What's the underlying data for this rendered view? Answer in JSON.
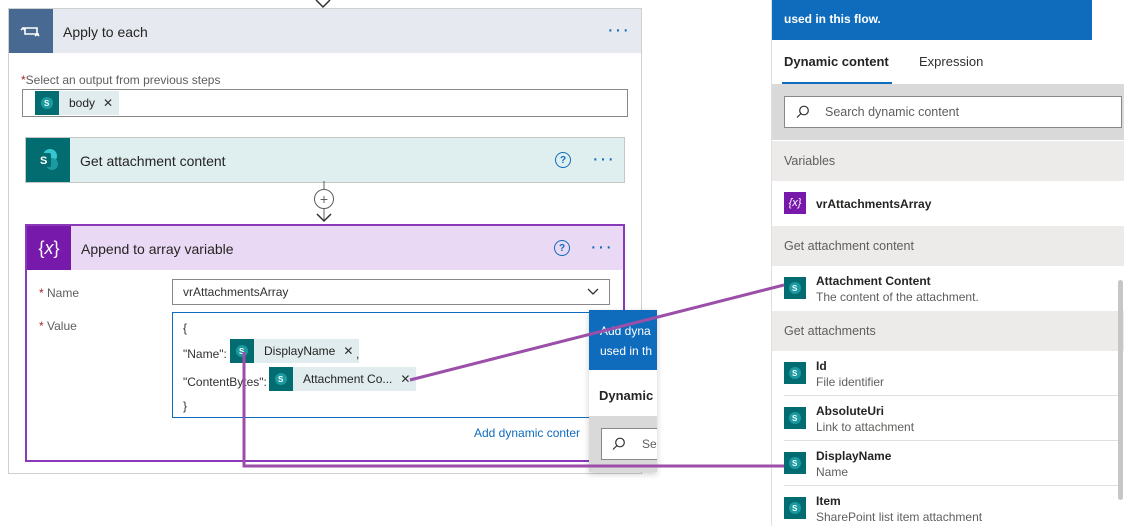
{
  "apply_each": {
    "title": "Apply to each",
    "output_label": "Select an output from previous steps",
    "output_token": "body"
  },
  "get_attachment": {
    "title": "Get attachment content"
  },
  "append": {
    "title": "Append to array variable",
    "name_label": "Name",
    "name_value": "vrAttachmentsArray",
    "value_label": "Value",
    "line_open": "{",
    "name_key": "\"Name\":",
    "name_token": "DisplayName",
    "comma": ",",
    "content_key": "\"ContentBytes\":",
    "content_token": "Attachment Co...",
    "line_close": "}",
    "add_dynamic": "Add dynamic conter"
  },
  "popup_small": {
    "banner_line1": "Add dyna",
    "banner_line2": "used in th",
    "tab": "Dynamic",
    "search_partial": "Se"
  },
  "panel": {
    "banner_text": "used in this flow.",
    "tabs": [
      "Dynamic content",
      "Expression"
    ],
    "search_placeholder": "Search dynamic content",
    "sections": [
      {
        "header": "Variables",
        "items": [
          {
            "title": "vrAttachmentsArray",
            "sub": ""
          }
        ]
      },
      {
        "header": "Get attachment content",
        "items": [
          {
            "title": "Attachment Content",
            "sub": "The content of the attachment."
          }
        ]
      },
      {
        "header": "Get attachments",
        "items": [
          {
            "title": "Id",
            "sub": "File identifier"
          },
          {
            "title": "AbsoluteUri",
            "sub": "Link to attachment"
          },
          {
            "title": "DisplayName",
            "sub": "Name"
          },
          {
            "title": "Item",
            "sub": "SharePoint list item attachment"
          }
        ]
      }
    ]
  },
  "colors": {
    "accent": "#0f6cbd",
    "sharepoint": "#036c70",
    "variable": "#7719aa",
    "annotation": "#9b4fa8"
  }
}
